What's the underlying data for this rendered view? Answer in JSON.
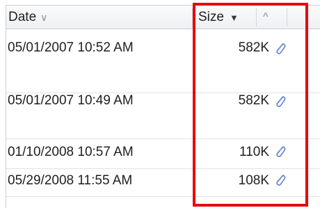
{
  "columns": {
    "date_label": "Date",
    "size_label": "Size",
    "chevron_down": "∨",
    "sort_desc_arrow": "▼",
    "collapse_chevron": "^"
  },
  "rows": [
    {
      "date": "05/01/2007 10:52 AM",
      "size": "582K",
      "attachment_icon": "paperclip-icon"
    },
    {
      "date": "05/01/2007 10:49 AM",
      "size": "582K",
      "attachment_icon": "paperclip-icon"
    },
    {
      "date": "01/10/2008 10:57 AM",
      "size": "110K",
      "attachment_icon": "paperclip-icon"
    },
    {
      "date": "05/29/2008 11:55 AM",
      "size": "108K",
      "attachment_icon": "paperclip-icon"
    }
  ],
  "colors": {
    "highlight": "#e8070d",
    "clip": "#6f8fcf"
  }
}
